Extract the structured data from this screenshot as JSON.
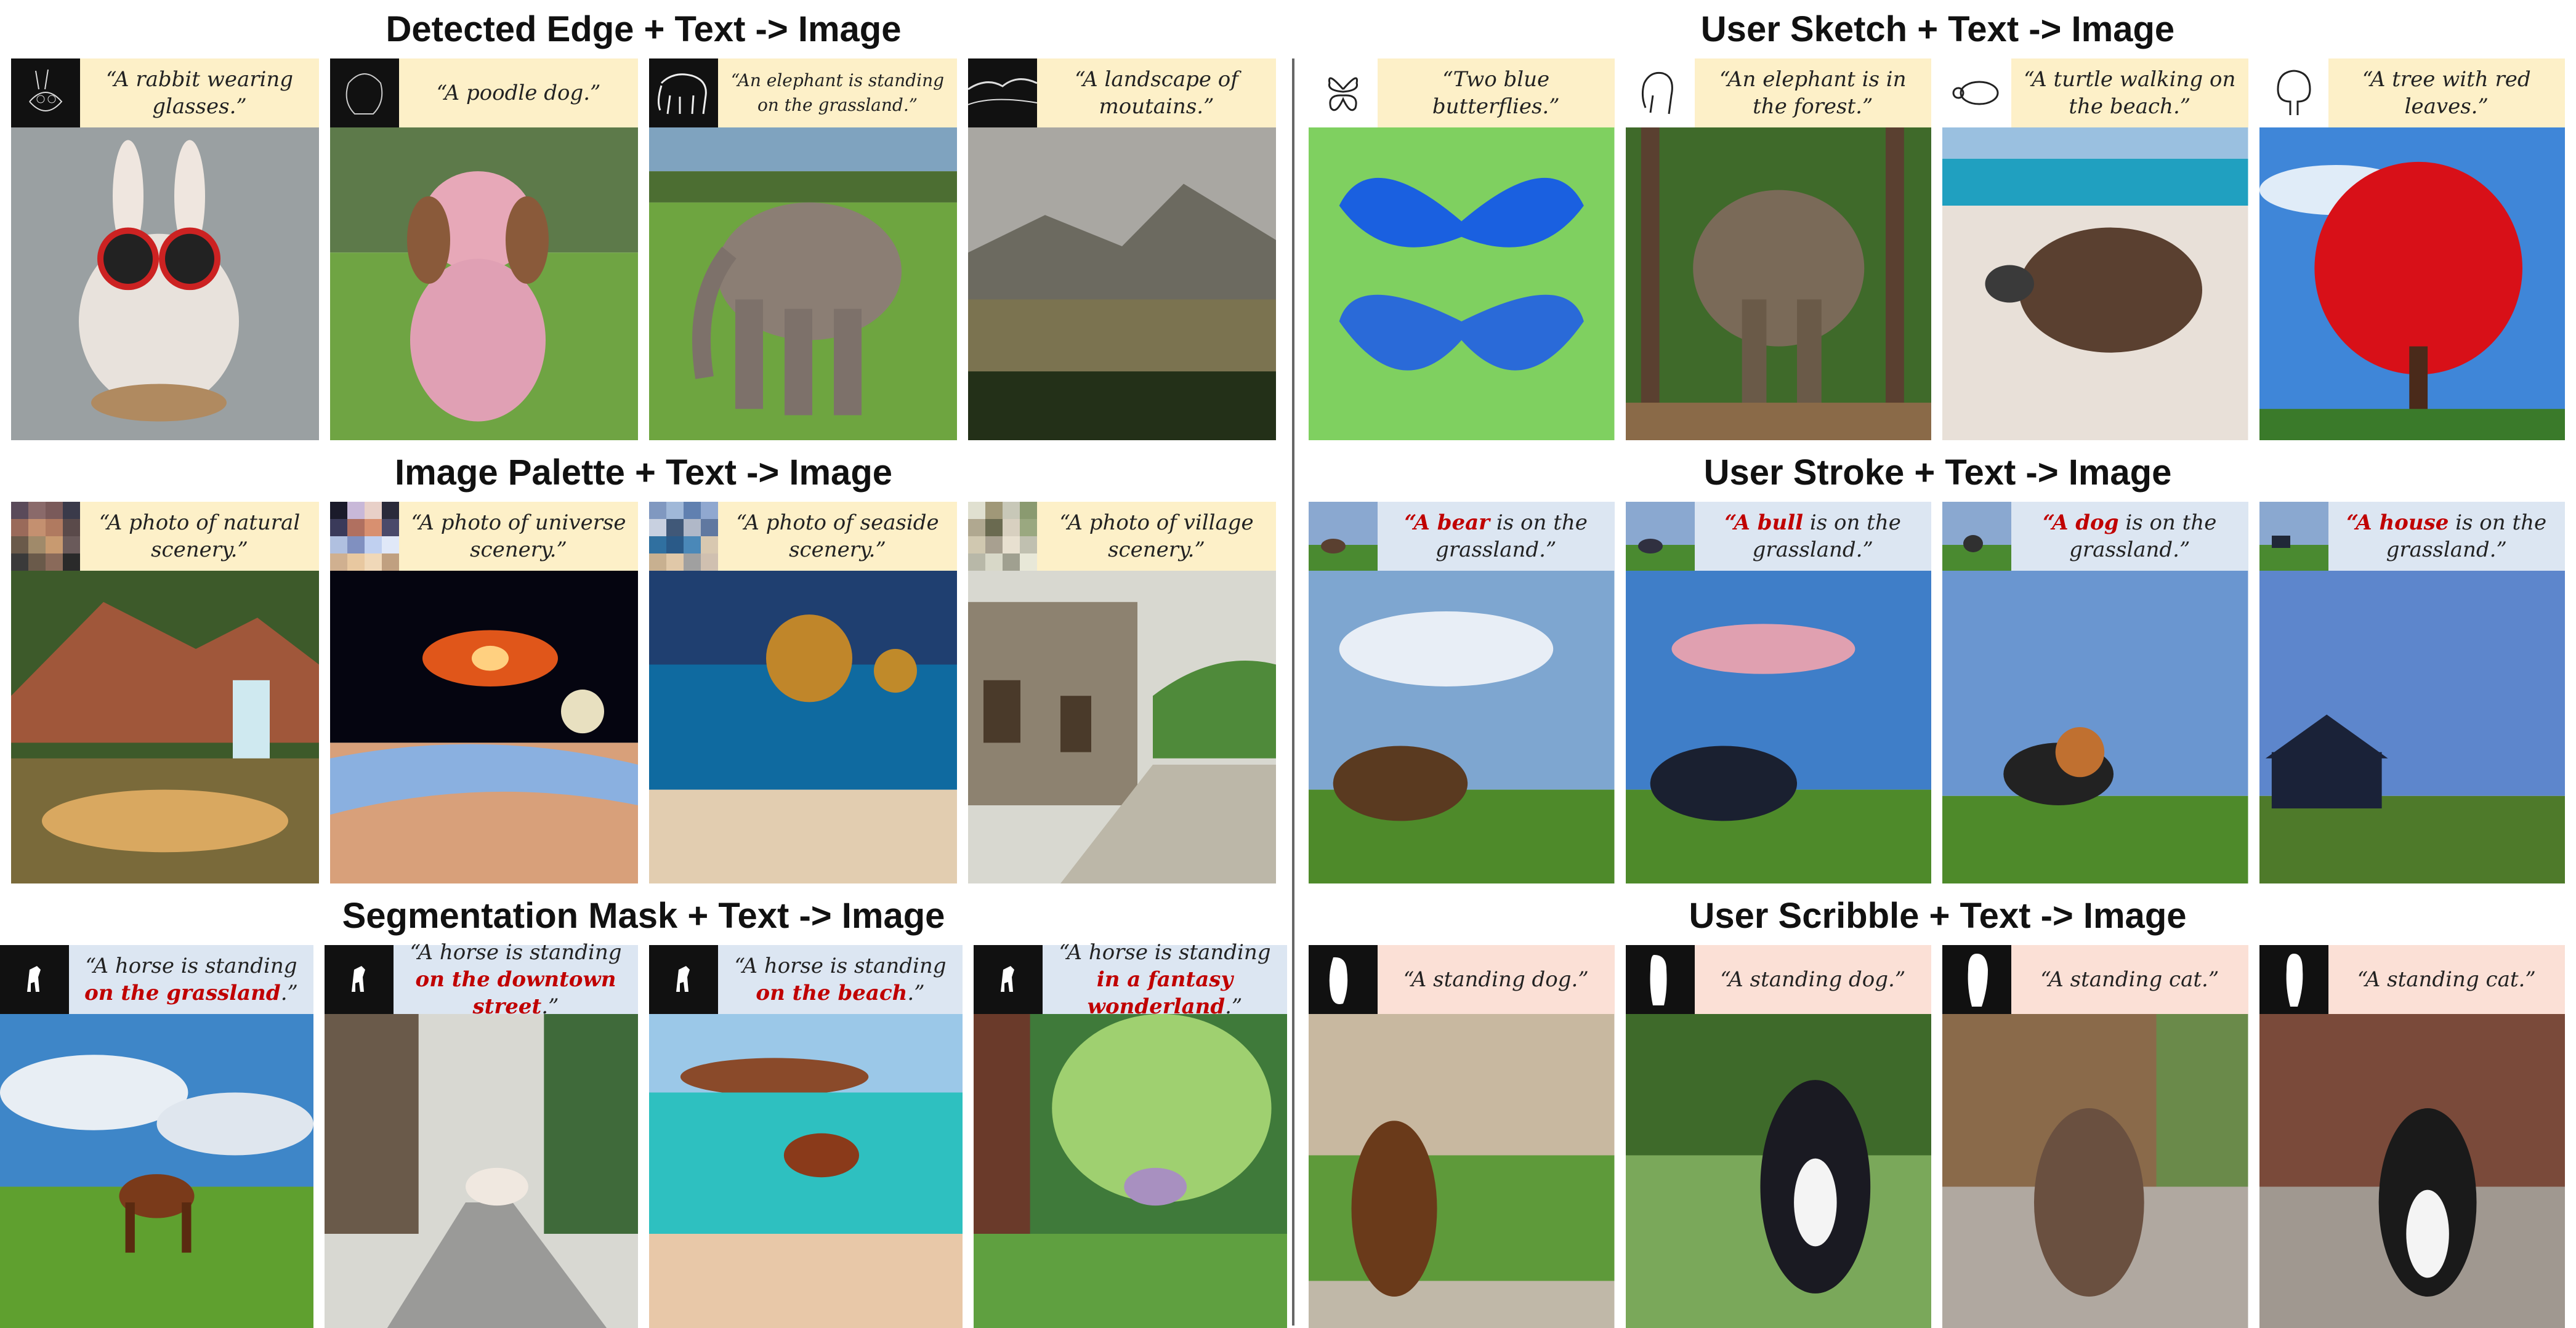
{
  "sections": {
    "edge": {
      "title": "Detected Edge + Text -> Image",
      "captions": [
        "“A rabbit wearing glasses.”",
        "“A poodle dog.”",
        "“An elephant is standing on the grassland.”",
        "“A landscape of moutains.”"
      ]
    },
    "palette": {
      "title": "Image Palette + Text -> Image",
      "captions": [
        "“A photo of natural scenery.”",
        "“A photo of universe scenery.”",
        "“A photo of seaside scenery.”",
        "“A photo of village scenery.”"
      ]
    },
    "segmentation": {
      "title": "Segmentation Mask + Text -> Image",
      "prefix": "“A horse is standing ",
      "suffix": ".”",
      "highlights": [
        "on the grassland",
        "on the downtown street",
        "on the beach",
        "in a fantasy wonderland"
      ]
    },
    "sketch": {
      "title": "User Sketch + Text -> Image",
      "captions": [
        "“Two blue butterflies.”",
        "“An elephant is in the forest.”",
        "“A turtle walking on the beach.”",
        "“A tree with red leaves.”"
      ]
    },
    "stroke": {
      "title": "User Stroke + Text -> Image",
      "highlights": [
        "“A bear",
        "“A bull",
        "“A dog",
        "“A house"
      ],
      "suffix": " is on the grassland.”"
    },
    "scribble": {
      "title": "User Scribble + Text -> Image",
      "captions": [
        "“A standing dog.”",
        "“A standing dog.”",
        "“A standing cat.”",
        "“A standing cat.”"
      ]
    }
  },
  "colors": {
    "edge_caption_bg": "#fdf0c8",
    "palette_caption_bg": "#fdf0c8",
    "sketch_caption_bg": "#fdf0c8",
    "segmentation_caption_bg": "#dce6f2",
    "stroke_caption_bg": "#dce6f2",
    "scribble_caption_bg": "#fbe0d6",
    "highlight_red": "#c00000"
  }
}
